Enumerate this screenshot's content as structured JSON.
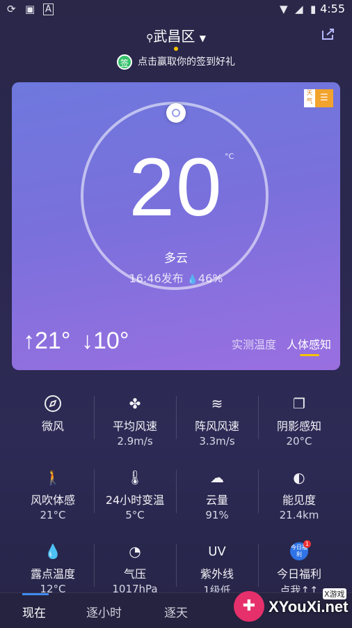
{
  "status_bar": {
    "time": "4:55",
    "left_icons": [
      "sync-icon",
      "image-icon",
      "text-a-icon"
    ],
    "right_icons": [
      "wifi-icon",
      "signal-icon",
      "battery-icon"
    ]
  },
  "header": {
    "location": "武昌区",
    "banner_badge": "签",
    "banner_text": "点击赢取你的签到好礼"
  },
  "card": {
    "temperature": "20",
    "unit": "°C",
    "condition": "多云",
    "publish": "16:46发布",
    "humidity": "46%",
    "high": "↑21°",
    "low": "↓10°",
    "tab_measured": "实测温度",
    "tab_feel": "人体感知",
    "ad": {
      "small": "天气",
      "icon": "☰"
    }
  },
  "details": [
    [
      {
        "icon": "compass-icon",
        "label": "微风",
        "value": ""
      },
      {
        "icon": "fan-icon",
        "label": "平均风速",
        "value": "2.9m/s"
      },
      {
        "icon": "wind-icon",
        "label": "阵风风速",
        "value": "3.3m/s"
      },
      {
        "icon": "shade-icon",
        "label": "阴影感知",
        "value": "20°C"
      }
    ],
    [
      {
        "icon": "wind-person-icon",
        "label": "风吹体感",
        "value": "21°C"
      },
      {
        "icon": "thermometer-clock-icon",
        "label": "24小时变温",
        "value": "5°C"
      },
      {
        "icon": "cloud-icon",
        "label": "云量",
        "value": "91%"
      },
      {
        "icon": "visibility-icon",
        "label": "能见度",
        "value": "21.4km"
      }
    ],
    [
      {
        "icon": "droplet-icon",
        "label": "露点温度",
        "value": "12°C"
      },
      {
        "icon": "gauge-icon",
        "label": "气压",
        "value": "1017hPa"
      },
      {
        "icon": "uv-icon",
        "label": "紫外线",
        "value": "1级低",
        "icon_text": "UV"
      },
      {
        "icon": "gift-icon",
        "label": "今日福利",
        "value": "点我↑↑",
        "icon_text": "今日福利",
        "badge": "1"
      }
    ]
  ],
  "bottom_nav": {
    "tabs": [
      "现在",
      "逐小时",
      "逐天"
    ],
    "active": 0
  },
  "watermark": {
    "small": "X游戏",
    "big": "XYouXi.net"
  }
}
